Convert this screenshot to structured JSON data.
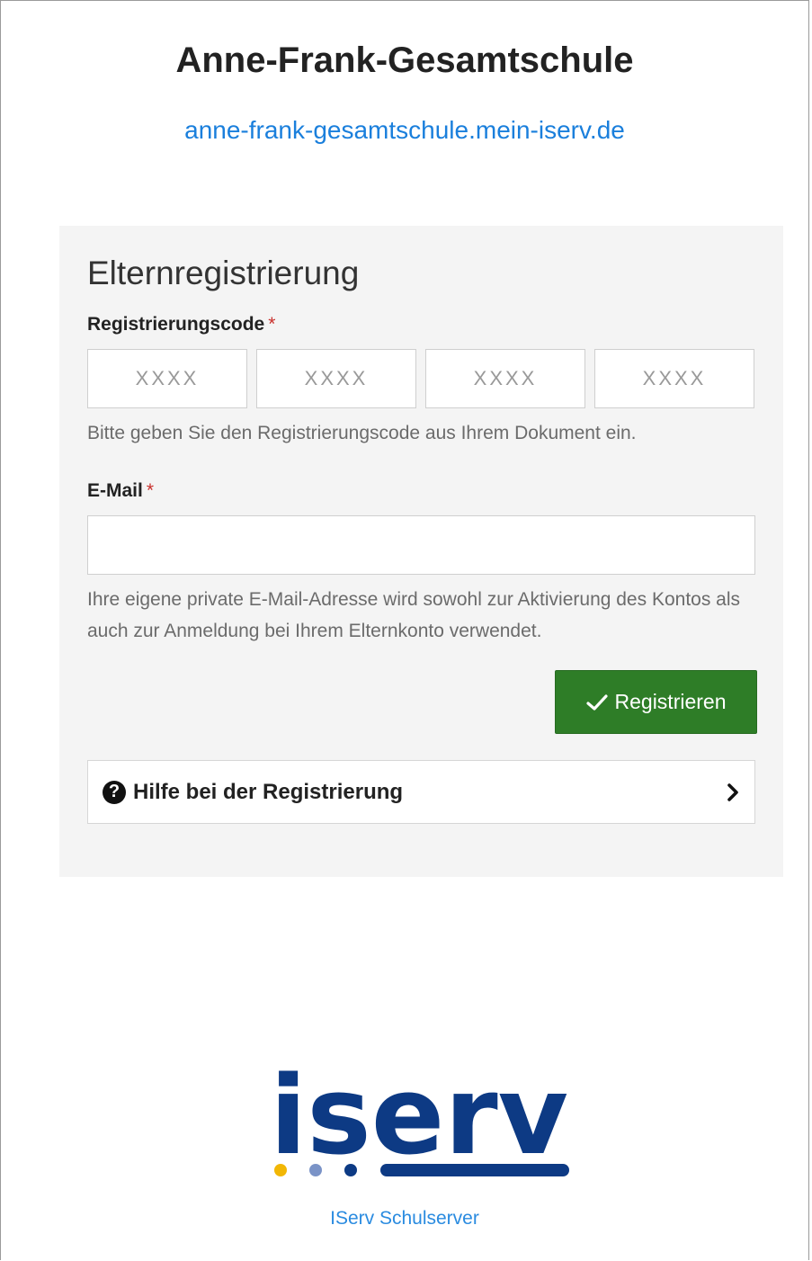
{
  "header": {
    "school_name": "Anne-Frank-Gesamtschule",
    "school_url": "anne-frank-gesamtschule.mein-iserv.de"
  },
  "form": {
    "title": "Elternregistrierung",
    "code": {
      "label": "Registrierungscode",
      "required_mark": "*",
      "placeholders": [
        "XXXX",
        "XXXX",
        "XXXX",
        "XXXX"
      ],
      "values": [
        "",
        "",
        "",
        ""
      ],
      "help": "Bitte geben Sie den Registrierungscode aus Ihrem Dokument ein."
    },
    "email": {
      "label": "E-Mail",
      "required_mark": "*",
      "value": "",
      "placeholder": "",
      "help": "Ihre eigene private E-Mail-Adresse wird sowohl zur Aktivierung des Kontos als auch zur Anmeldung bei Ihrem Elternkonto verwendet."
    },
    "submit_label": "Registrieren",
    "help_link_label": "Hilfe bei der Registrierung"
  },
  "footer": {
    "logo_text": "iserv",
    "link_label": "IServ Schulserver"
  },
  "icons": {
    "submit": "check-icon",
    "help": "question-circle-icon",
    "help_arrow": "chevron-right-icon"
  },
  "colors": {
    "link": "#1a7fdc",
    "button_bg": "#2e7d27",
    "required": "#c9302c",
    "panel_bg": "#f4f4f4",
    "logo_blue": "#0d3a84",
    "logo_yellow": "#f2b705",
    "logo_lightblue": "#7a93c7"
  }
}
